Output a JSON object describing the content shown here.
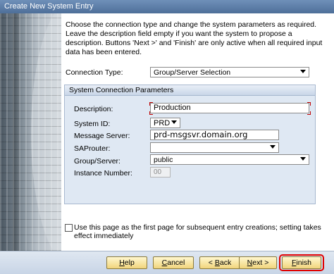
{
  "window": {
    "title": "Create New System Entry"
  },
  "intro": "Choose the connection type and change the system parameters as required. Leave the description field empty if you want the system to propose a description. Buttons 'Next >' and 'Finish' are only active when all required input data has been entered.",
  "connection": {
    "label": "Connection Type:",
    "value": "Group/Server Selection"
  },
  "params": {
    "title": "System Connection Parameters",
    "description_label": "Description:",
    "description_value": "Production",
    "system_id_label": "System ID:",
    "system_id_value": "PRD",
    "message_server_label": "Message Server:",
    "message_server_value": "prd-msgsvr.domain.org",
    "saprouter_label": "SAProuter:",
    "saprouter_value": "",
    "group_server_label": "Group/Server:",
    "group_server_value": "public",
    "instance_label": "Instance Number:",
    "instance_value": "00"
  },
  "first_page_checkbox": {
    "label": "Use this page as the first page for subsequent entry creations; setting takes effect immediately",
    "checked": false
  },
  "buttons": {
    "help": {
      "pre": "",
      "u": "H",
      "post": "elp"
    },
    "cancel": {
      "pre": "",
      "u": "C",
      "post": "ancel"
    },
    "back": {
      "pre": "< ",
      "u": "B",
      "post": "ack"
    },
    "next": {
      "pre": "",
      "u": "N",
      "post": "ext >"
    },
    "finish": {
      "pre": "",
      "u": "F",
      "post": "inish"
    }
  },
  "colors": {
    "highlight_ring": "#e00000",
    "button_fill": "#f1d57c",
    "group_bg": "#dfe8f3"
  }
}
